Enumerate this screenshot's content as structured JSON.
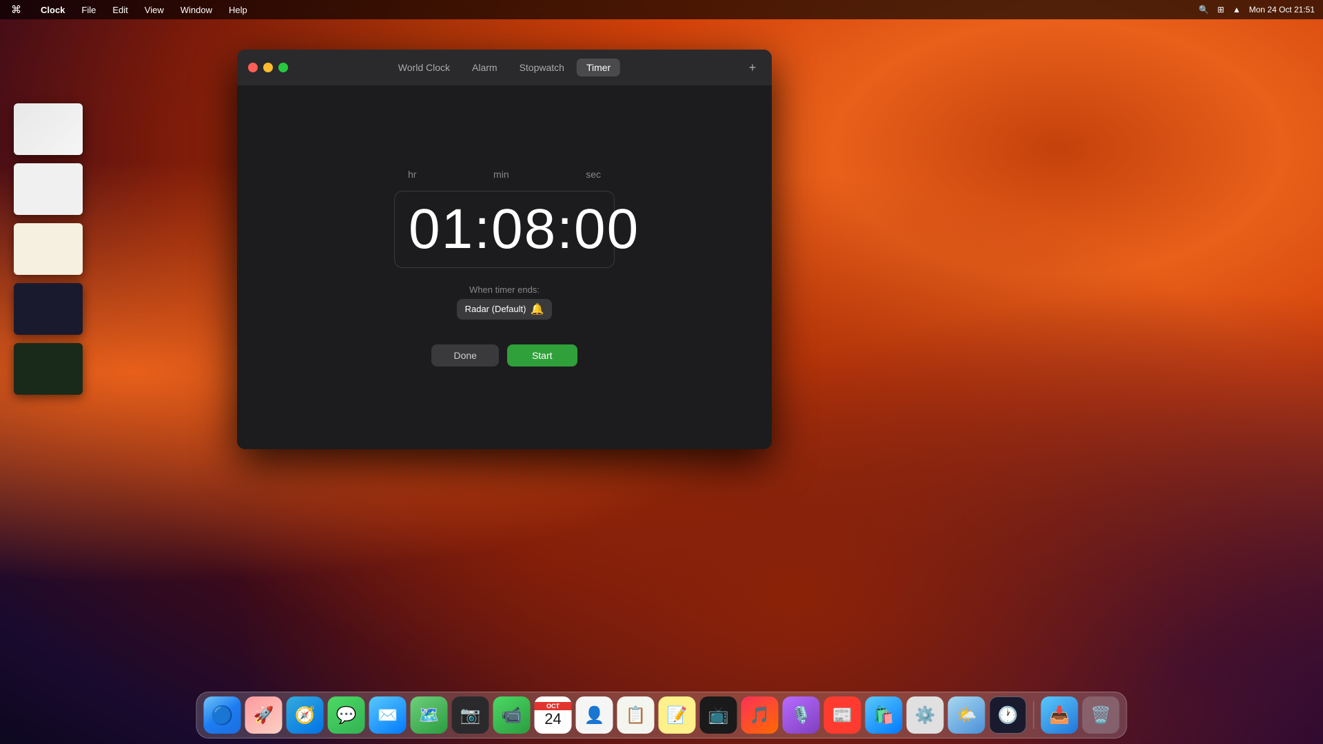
{
  "menubar": {
    "apple": "⌘",
    "app_name": "Clock",
    "menus": [
      "File",
      "Edit",
      "View",
      "Window",
      "Help"
    ],
    "right": {
      "datetime": "Mon 24 Oct  21:51"
    }
  },
  "clock_window": {
    "tabs": [
      {
        "id": "world-clock",
        "label": "World Clock",
        "active": false
      },
      {
        "id": "alarm",
        "label": "Alarm",
        "active": false
      },
      {
        "id": "stopwatch",
        "label": "Stopwatch",
        "active": false
      },
      {
        "id": "timer",
        "label": "Timer",
        "active": true
      }
    ],
    "add_button": "+",
    "timer": {
      "hr_label": "hr",
      "min_label": "min",
      "sec_label": "sec",
      "display": "01:08:00",
      "when_ends_label": "When timer ends:",
      "sound_name": "Radar (Default)",
      "sound_emoji": "🔔",
      "btn_done": "Done",
      "btn_start": "Start"
    }
  },
  "dock": {
    "items": [
      {
        "id": "finder",
        "emoji": "🔵",
        "label": "Finder"
      },
      {
        "id": "launchpad",
        "emoji": "🚀",
        "label": "Launchpad"
      },
      {
        "id": "safari",
        "emoji": "🧭",
        "label": "Safari"
      },
      {
        "id": "messages",
        "emoji": "💬",
        "label": "Messages"
      },
      {
        "id": "mail",
        "emoji": "✉️",
        "label": "Mail"
      },
      {
        "id": "maps",
        "emoji": "🗺️",
        "label": "Maps"
      },
      {
        "id": "photos",
        "emoji": "📷",
        "label": "Photos"
      },
      {
        "id": "facetime",
        "emoji": "📹",
        "label": "FaceTime"
      },
      {
        "id": "calendar",
        "label": "Calendar",
        "type": "calendar",
        "month": "OCT",
        "day": "24"
      },
      {
        "id": "contacts",
        "emoji": "👤",
        "label": "Contacts"
      },
      {
        "id": "reminders",
        "emoji": "📋",
        "label": "Reminders"
      },
      {
        "id": "notes",
        "emoji": "📝",
        "label": "Notes"
      },
      {
        "id": "appletv",
        "emoji": "📺",
        "label": "Apple TV"
      },
      {
        "id": "music",
        "emoji": "🎵",
        "label": "Music"
      },
      {
        "id": "podcasts",
        "emoji": "🎙️",
        "label": "Podcasts"
      },
      {
        "id": "news",
        "emoji": "📰",
        "label": "News"
      },
      {
        "id": "appstore",
        "emoji": "🛍️",
        "label": "App Store"
      },
      {
        "id": "syspreferences",
        "emoji": "⚙️",
        "label": "System Preferences"
      },
      {
        "id": "weather",
        "emoji": "🌤️",
        "label": "Weather"
      },
      {
        "id": "clock",
        "emoji": "🕐",
        "label": "Clock"
      },
      {
        "id": "airdrop",
        "emoji": "📥",
        "label": "AirDrop"
      },
      {
        "id": "trash",
        "emoji": "🗑️",
        "label": "Trash"
      }
    ]
  }
}
